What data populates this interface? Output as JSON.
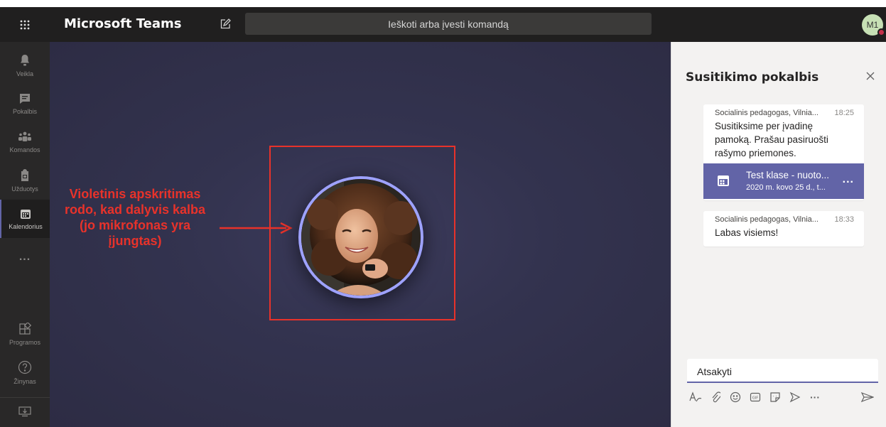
{
  "app": {
    "title": "Microsoft Teams",
    "search_placeholder": "Ieškoti arba įvesti komandą",
    "user_initials": "M1"
  },
  "rail": {
    "items": [
      {
        "label": "Veikla",
        "icon": "bell-icon"
      },
      {
        "label": "Pokalbis",
        "icon": "chat-icon"
      },
      {
        "label": "Komandos",
        "icon": "teams-icon"
      },
      {
        "label": "Užduotys",
        "icon": "assignments-icon"
      },
      {
        "label": "Kalendorius",
        "icon": "calendar-icon",
        "active": true
      },
      {
        "label": "...",
        "icon": "more-icon"
      },
      {
        "label": "Programos",
        "icon": "apps-icon"
      },
      {
        "label": "Žinynas",
        "icon": "help-icon"
      },
      {
        "label": "",
        "icon": "download-icon"
      }
    ]
  },
  "stage": {
    "annotation": "Violetinis apskritimas rodo, kad dalyvis kalba (jo mikrofonas yra įjungtas)",
    "annotation_color": "#e8322a",
    "speaking_ring_color": "#9ea2ff"
  },
  "chat": {
    "title": "Susitikimo pokalbis",
    "messages": [
      {
        "author": "Socialinis pedagogas, Vilnia...",
        "time": "18:25",
        "text": "Susitiksime per įvadinę pamoką. Prašau pasiruošti rašymo priemones.",
        "card": {
          "title": "Test klase - nuoto...",
          "subtitle": "2020 m. kovo 25 d., t...",
          "more": "..."
        }
      },
      {
        "author": "Socialinis pedagogas, Vilnia...",
        "time": "18:33",
        "text": "Labas visiems!"
      }
    ],
    "reply_placeholder": "Atsakyti",
    "accent_color": "#6264a7"
  }
}
